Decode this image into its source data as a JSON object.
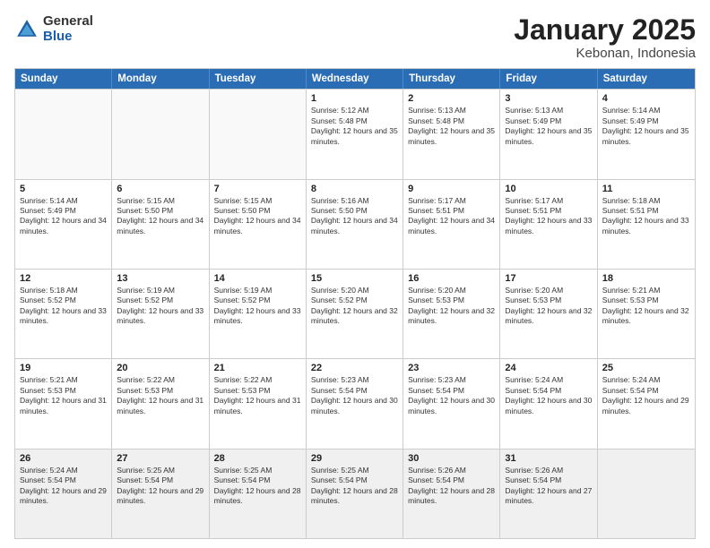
{
  "header": {
    "logo": {
      "general": "General",
      "blue": "Blue"
    },
    "title": "January 2025",
    "subtitle": "Kebonan, Indonesia"
  },
  "calendar": {
    "days_of_week": [
      "Sunday",
      "Monday",
      "Tuesday",
      "Wednesday",
      "Thursday",
      "Friday",
      "Saturday"
    ],
    "weeks": [
      [
        {
          "day": "",
          "sunrise": "",
          "sunset": "",
          "daylight": "",
          "empty": true
        },
        {
          "day": "",
          "sunrise": "",
          "sunset": "",
          "daylight": "",
          "empty": true
        },
        {
          "day": "",
          "sunrise": "",
          "sunset": "",
          "daylight": "",
          "empty": true
        },
        {
          "day": "1",
          "sunrise": "Sunrise: 5:12 AM",
          "sunset": "Sunset: 5:48 PM",
          "daylight": "Daylight: 12 hours and 35 minutes.",
          "empty": false
        },
        {
          "day": "2",
          "sunrise": "Sunrise: 5:13 AM",
          "sunset": "Sunset: 5:48 PM",
          "daylight": "Daylight: 12 hours and 35 minutes.",
          "empty": false
        },
        {
          "day": "3",
          "sunrise": "Sunrise: 5:13 AM",
          "sunset": "Sunset: 5:49 PM",
          "daylight": "Daylight: 12 hours and 35 minutes.",
          "empty": false
        },
        {
          "day": "4",
          "sunrise": "Sunrise: 5:14 AM",
          "sunset": "Sunset: 5:49 PM",
          "daylight": "Daylight: 12 hours and 35 minutes.",
          "empty": false
        }
      ],
      [
        {
          "day": "5",
          "sunrise": "Sunrise: 5:14 AM",
          "sunset": "Sunset: 5:49 PM",
          "daylight": "Daylight: 12 hours and 34 minutes.",
          "empty": false
        },
        {
          "day": "6",
          "sunrise": "Sunrise: 5:15 AM",
          "sunset": "Sunset: 5:50 PM",
          "daylight": "Daylight: 12 hours and 34 minutes.",
          "empty": false
        },
        {
          "day": "7",
          "sunrise": "Sunrise: 5:15 AM",
          "sunset": "Sunset: 5:50 PM",
          "daylight": "Daylight: 12 hours and 34 minutes.",
          "empty": false
        },
        {
          "day": "8",
          "sunrise": "Sunrise: 5:16 AM",
          "sunset": "Sunset: 5:50 PM",
          "daylight": "Daylight: 12 hours and 34 minutes.",
          "empty": false
        },
        {
          "day": "9",
          "sunrise": "Sunrise: 5:17 AM",
          "sunset": "Sunset: 5:51 PM",
          "daylight": "Daylight: 12 hours and 34 minutes.",
          "empty": false
        },
        {
          "day": "10",
          "sunrise": "Sunrise: 5:17 AM",
          "sunset": "Sunset: 5:51 PM",
          "daylight": "Daylight: 12 hours and 33 minutes.",
          "empty": false
        },
        {
          "day": "11",
          "sunrise": "Sunrise: 5:18 AM",
          "sunset": "Sunset: 5:51 PM",
          "daylight": "Daylight: 12 hours and 33 minutes.",
          "empty": false
        }
      ],
      [
        {
          "day": "12",
          "sunrise": "Sunrise: 5:18 AM",
          "sunset": "Sunset: 5:52 PM",
          "daylight": "Daylight: 12 hours and 33 minutes.",
          "empty": false
        },
        {
          "day": "13",
          "sunrise": "Sunrise: 5:19 AM",
          "sunset": "Sunset: 5:52 PM",
          "daylight": "Daylight: 12 hours and 33 minutes.",
          "empty": false
        },
        {
          "day": "14",
          "sunrise": "Sunrise: 5:19 AM",
          "sunset": "Sunset: 5:52 PM",
          "daylight": "Daylight: 12 hours and 33 minutes.",
          "empty": false
        },
        {
          "day": "15",
          "sunrise": "Sunrise: 5:20 AM",
          "sunset": "Sunset: 5:52 PM",
          "daylight": "Daylight: 12 hours and 32 minutes.",
          "empty": false
        },
        {
          "day": "16",
          "sunrise": "Sunrise: 5:20 AM",
          "sunset": "Sunset: 5:53 PM",
          "daylight": "Daylight: 12 hours and 32 minutes.",
          "empty": false
        },
        {
          "day": "17",
          "sunrise": "Sunrise: 5:20 AM",
          "sunset": "Sunset: 5:53 PM",
          "daylight": "Daylight: 12 hours and 32 minutes.",
          "empty": false
        },
        {
          "day": "18",
          "sunrise": "Sunrise: 5:21 AM",
          "sunset": "Sunset: 5:53 PM",
          "daylight": "Daylight: 12 hours and 32 minutes.",
          "empty": false
        }
      ],
      [
        {
          "day": "19",
          "sunrise": "Sunrise: 5:21 AM",
          "sunset": "Sunset: 5:53 PM",
          "daylight": "Daylight: 12 hours and 31 minutes.",
          "empty": false
        },
        {
          "day": "20",
          "sunrise": "Sunrise: 5:22 AM",
          "sunset": "Sunset: 5:53 PM",
          "daylight": "Daylight: 12 hours and 31 minutes.",
          "empty": false
        },
        {
          "day": "21",
          "sunrise": "Sunrise: 5:22 AM",
          "sunset": "Sunset: 5:53 PM",
          "daylight": "Daylight: 12 hours and 31 minutes.",
          "empty": false
        },
        {
          "day": "22",
          "sunrise": "Sunrise: 5:23 AM",
          "sunset": "Sunset: 5:54 PM",
          "daylight": "Daylight: 12 hours and 30 minutes.",
          "empty": false
        },
        {
          "day": "23",
          "sunrise": "Sunrise: 5:23 AM",
          "sunset": "Sunset: 5:54 PM",
          "daylight": "Daylight: 12 hours and 30 minutes.",
          "empty": false
        },
        {
          "day": "24",
          "sunrise": "Sunrise: 5:24 AM",
          "sunset": "Sunset: 5:54 PM",
          "daylight": "Daylight: 12 hours and 30 minutes.",
          "empty": false
        },
        {
          "day": "25",
          "sunrise": "Sunrise: 5:24 AM",
          "sunset": "Sunset: 5:54 PM",
          "daylight": "Daylight: 12 hours and 29 minutes.",
          "empty": false
        }
      ],
      [
        {
          "day": "26",
          "sunrise": "Sunrise: 5:24 AM",
          "sunset": "Sunset: 5:54 PM",
          "daylight": "Daylight: 12 hours and 29 minutes.",
          "empty": false
        },
        {
          "day": "27",
          "sunrise": "Sunrise: 5:25 AM",
          "sunset": "Sunset: 5:54 PM",
          "daylight": "Daylight: 12 hours and 29 minutes.",
          "empty": false
        },
        {
          "day": "28",
          "sunrise": "Sunrise: 5:25 AM",
          "sunset": "Sunset: 5:54 PM",
          "daylight": "Daylight: 12 hours and 28 minutes.",
          "empty": false
        },
        {
          "day": "29",
          "sunrise": "Sunrise: 5:25 AM",
          "sunset": "Sunset: 5:54 PM",
          "daylight": "Daylight: 12 hours and 28 minutes.",
          "empty": false
        },
        {
          "day": "30",
          "sunrise": "Sunrise: 5:26 AM",
          "sunset": "Sunset: 5:54 PM",
          "daylight": "Daylight: 12 hours and 28 minutes.",
          "empty": false
        },
        {
          "day": "31",
          "sunrise": "Sunrise: 5:26 AM",
          "sunset": "Sunset: 5:54 PM",
          "daylight": "Daylight: 12 hours and 27 minutes.",
          "empty": false
        },
        {
          "day": "",
          "sunrise": "",
          "sunset": "",
          "daylight": "",
          "empty": true
        }
      ]
    ]
  }
}
